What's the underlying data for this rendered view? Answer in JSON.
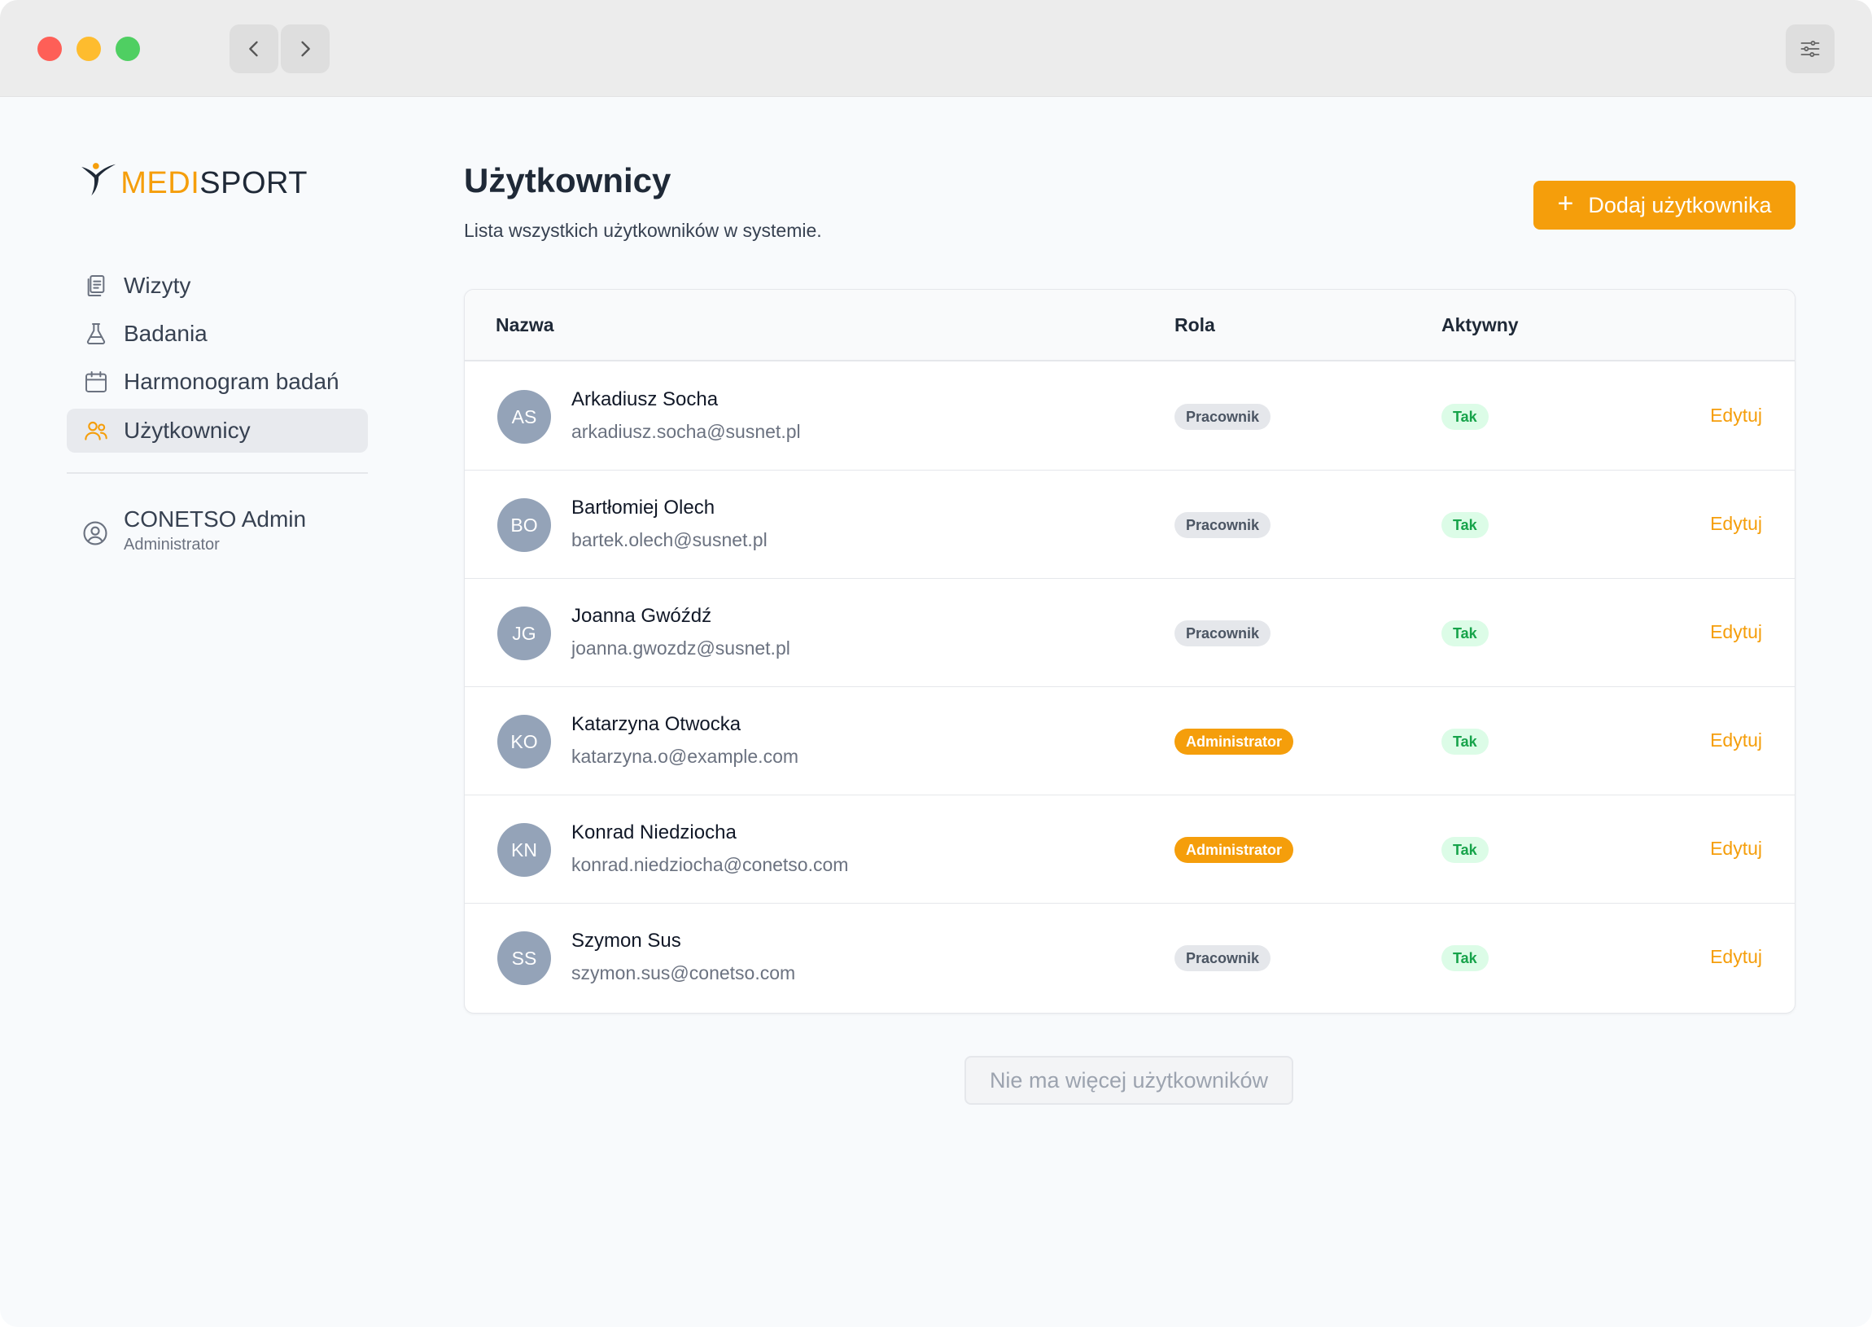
{
  "brand": {
    "logo_medi": "MEDI",
    "logo_sport": "SPORT",
    "accent": "#f59e0b"
  },
  "sidebar": {
    "items": [
      {
        "label": "Wizyty",
        "icon": "clipboard-icon",
        "active": false
      },
      {
        "label": "Badania",
        "icon": "flask-icon",
        "active": false
      },
      {
        "label": "Harmonogram badań",
        "icon": "calendar-icon",
        "active": false
      },
      {
        "label": "Użytkownicy",
        "icon": "users-icon",
        "active": true
      }
    ],
    "user": {
      "name": "CONETSO Admin",
      "role": "Administrator"
    }
  },
  "header": {
    "title": "Użytkownicy",
    "subtitle": "Lista wszystkich użytkowników w systemie.",
    "add_button": "Dodaj użytkownika"
  },
  "table": {
    "columns": {
      "name": "Nazwa",
      "role": "Rola",
      "active": "Aktywny"
    },
    "rows": [
      {
        "initials": "AS",
        "name": "Arkadiusz Socha",
        "email": "arkadiusz.socha@susnet.pl",
        "role": "Pracownik",
        "active": "Tak",
        "action": "Edytuj"
      },
      {
        "initials": "BO",
        "name": "Bartłomiej Olech",
        "email": "bartek.olech@susnet.pl",
        "role": "Pracownik",
        "active": "Tak",
        "action": "Edytuj"
      },
      {
        "initials": "JG",
        "name": "Joanna Gwóźdź",
        "email": "joanna.gwozdz@susnet.pl",
        "role": "Pracownik",
        "active": "Tak",
        "action": "Edytuj"
      },
      {
        "initials": "KO",
        "name": "Katarzyna Otwocka",
        "email": "katarzyna.o@example.com",
        "role": "Administrator",
        "active": "Tak",
        "action": "Edytuj"
      },
      {
        "initials": "KN",
        "name": "Konrad Niedziocha",
        "email": "konrad.niedziocha@conetso.com",
        "role": "Administrator",
        "active": "Tak",
        "action": "Edytuj"
      },
      {
        "initials": "SS",
        "name": "Szymon Sus",
        "email": "szymon.sus@conetso.com",
        "role": "Pracownik",
        "active": "Tak",
        "action": "Edytuj"
      }
    ]
  },
  "footer": {
    "more_label": "Nie ma więcej użytkowników"
  }
}
